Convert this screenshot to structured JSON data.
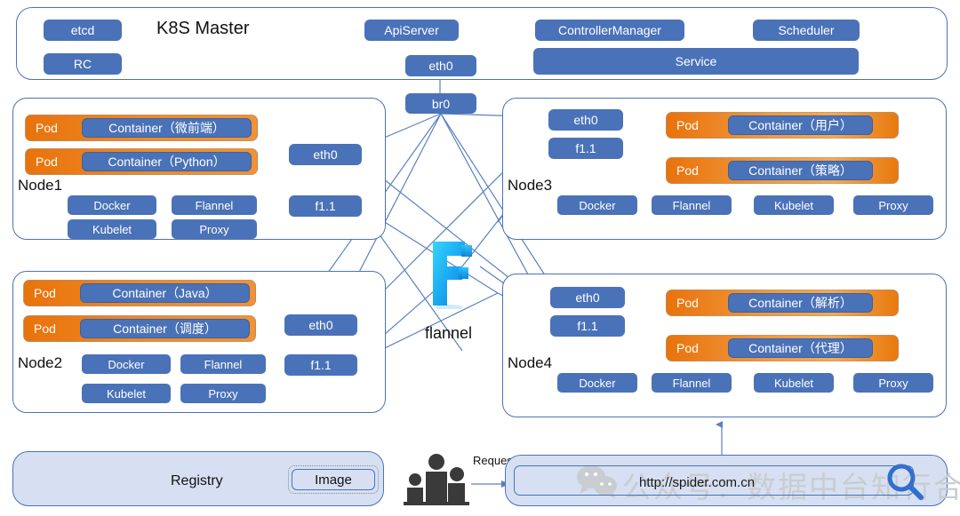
{
  "master": {
    "title": "K8S Master",
    "boxes": [
      {
        "label": "etcd"
      },
      {
        "label": "RC"
      },
      {
        "label": "ApiServer"
      },
      {
        "label": "eth0"
      },
      {
        "label": "ControllerManager"
      },
      {
        "label": "Scheduler"
      },
      {
        "label": "Service"
      }
    ]
  },
  "bridge": {
    "label": "br0"
  },
  "flannel": {
    "label": "flannel",
    "logo_letter": "F"
  },
  "nodes": [
    {
      "name": "Node1",
      "pods": [
        {
          "pod_label": "Pod",
          "container_label": "Container（微前端）"
        },
        {
          "pod_label": "Pod",
          "container_label": "Container（Python）"
        }
      ],
      "net": [
        {
          "label": "eth0"
        },
        {
          "label": "f1.1"
        }
      ],
      "services": [
        "Docker",
        "Flannel",
        "Kubelet",
        "Proxy"
      ]
    },
    {
      "name": "Node2",
      "pods": [
        {
          "pod_label": "Pod",
          "container_label": "Container（Java）"
        },
        {
          "pod_label": "Pod",
          "container_label": "Container（调度）"
        }
      ],
      "net": [
        {
          "label": "eth0"
        },
        {
          "label": "f1.1"
        }
      ],
      "services": [
        "Docker",
        "Flannel",
        "Kubelet",
        "Proxy"
      ]
    },
    {
      "name": "Node3",
      "pods": [
        {
          "pod_label": "Pod",
          "container_label": "Container（用户）"
        },
        {
          "pod_label": "Pod",
          "container_label": "Container（策略）"
        }
      ],
      "net": [
        {
          "label": "eth0"
        },
        {
          "label": "f1.1"
        }
      ],
      "services": [
        "Docker",
        "Flannel",
        "Kubelet",
        "Proxy"
      ]
    },
    {
      "name": "Node4",
      "pods": [
        {
          "pod_label": "Pod",
          "container_label": "Container（解析）"
        },
        {
          "pod_label": "Pod",
          "container_label": "Container（代理）"
        }
      ],
      "net": [
        {
          "label": "eth0"
        },
        {
          "label": "f1.1"
        }
      ],
      "services": [
        "Docker",
        "Flannel",
        "Kubelet",
        "Proxy"
      ]
    }
  ],
  "registry": {
    "title": "Registry",
    "image_label": "Image"
  },
  "client": {
    "request_label": "Request",
    "url": "http://spider.com.cn"
  },
  "watermark": {
    "text": "公众号：数据中台知行合一"
  },
  "colors": {
    "blue": "#4a72b8",
    "orange": "#e8730c",
    "panel_fill": "#d6e0f2",
    "line": "#5b80c0"
  }
}
